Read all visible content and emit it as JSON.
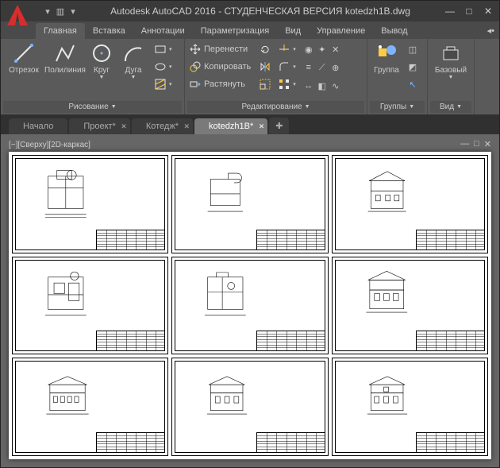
{
  "title": "Autodesk AutoCAD 2016 - СТУДЕНЧЕСКАЯ ВЕРСИЯ    kotedzh1B.dwg",
  "menu_tabs": [
    "Главная",
    "Вставка",
    "Аннотации",
    "Параметризация",
    "Вид",
    "Управление",
    "Вывод"
  ],
  "active_menu_tab": 0,
  "ribbon": {
    "draw": {
      "title": "Рисование",
      "line": "Отрезок",
      "polyline": "Полилиния",
      "circle": "Круг",
      "arc": "Дуга"
    },
    "edit": {
      "title": "Редактирование",
      "move": "Перенести",
      "copy": "Копировать",
      "stretch": "Растянуть"
    },
    "groups": {
      "title": "Группы",
      "group": "Группа"
    },
    "view": {
      "title": "Вид",
      "base": "Базовый"
    }
  },
  "doc_tabs": [
    {
      "label": "Начало",
      "active": false
    },
    {
      "label": "Проект*",
      "active": false
    },
    {
      "label": "Котедж*",
      "active": false
    },
    {
      "label": "kotedzh1B*",
      "active": true
    }
  ],
  "viewport_label": "[−][Сверху][2D-каркас]"
}
